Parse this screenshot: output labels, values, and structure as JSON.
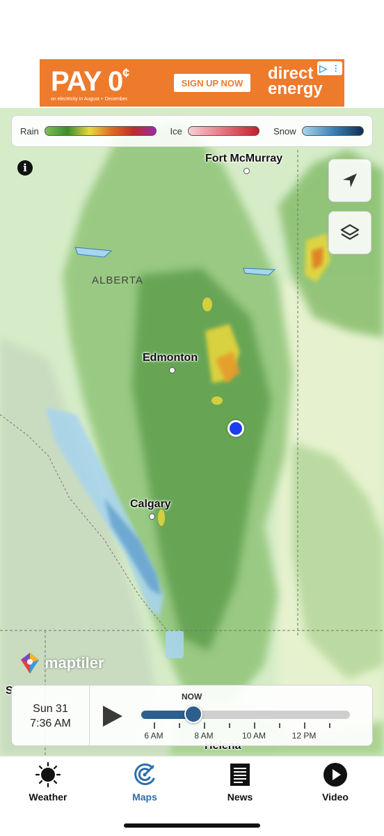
{
  "ad": {
    "headline": "PAY 0",
    "cents": "¢",
    "subtext": "on electricity in August + December.",
    "cta": "SIGN UP NOW",
    "brand_line1": "direct",
    "brand_line2": "energy",
    "colors": {
      "background": "#ee7a2b",
      "text": "#ffffff"
    }
  },
  "legend": {
    "rain_label": "Rain",
    "ice_label": "Ice",
    "snow_label": "Snow"
  },
  "map": {
    "region_label": "ALBERTA",
    "cities": {
      "fort_mcmurray": "Fort McMurray",
      "edmonton": "Edmonton",
      "calgary": "Calgary",
      "helena": "Helena",
      "edge_letter": "S"
    },
    "attribution": "maptiler",
    "location_color": "#1c3cf0"
  },
  "timeline": {
    "day": "Sun 31",
    "time": "7:36  AM",
    "now_label": "NOW",
    "labels": [
      "6 AM",
      "8 AM",
      "10 AM",
      "12 PM"
    ],
    "progress_fraction": 0.25,
    "colors": {
      "fill": "#2b5f8e",
      "track": "#cfcfcf"
    }
  },
  "tabs": [
    {
      "label": "Weather",
      "icon": "sun-icon",
      "active": false
    },
    {
      "label": "Maps",
      "icon": "radar-icon",
      "active": true
    },
    {
      "label": "News",
      "icon": "newspaper-icon",
      "active": false
    },
    {
      "label": "Video",
      "icon": "play-circle-icon",
      "active": false
    }
  ],
  "colors": {
    "tab_active": "#2b6da8",
    "tab_inactive": "#111111"
  }
}
